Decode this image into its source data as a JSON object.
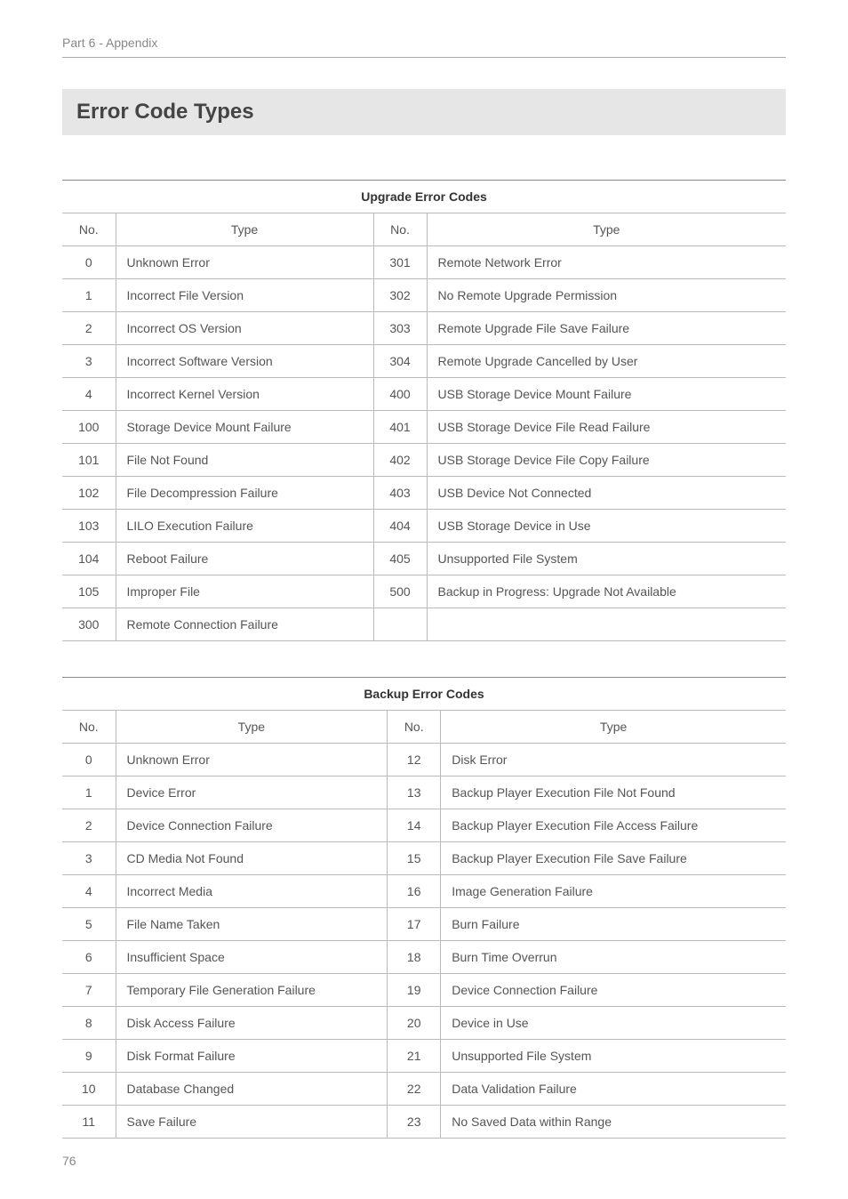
{
  "header": "Part 6 - Appendix",
  "section_title": "Error Code Types",
  "page_number": "76",
  "chart_data": [
    {
      "type": "table",
      "title": "Upgrade Error Codes",
      "columns": [
        "No.",
        "Type",
        "No.",
        "Type"
      ],
      "rows": [
        [
          "0",
          "Unknown Error",
          "301",
          "Remote Network Error"
        ],
        [
          "1",
          "Incorrect File Version",
          "302",
          "No Remote Upgrade Permission"
        ],
        [
          "2",
          "Incorrect OS Version",
          "303",
          "Remote Upgrade File Save Failure"
        ],
        [
          "3",
          "Incorrect Software Version",
          "304",
          "Remote Upgrade Cancelled by User"
        ],
        [
          "4",
          "Incorrect Kernel Version",
          "400",
          "USB Storage Device Mount Failure"
        ],
        [
          "100",
          "Storage Device Mount Failure",
          "401",
          "USB Storage Device File Read Failure"
        ],
        [
          "101",
          "File Not Found",
          "402",
          "USB Storage Device File Copy Failure"
        ],
        [
          "102",
          "File Decompression Failure",
          "403",
          "USB Device Not Connected"
        ],
        [
          "103",
          "LILO Execution Failure",
          "404",
          "USB Storage Device in Use"
        ],
        [
          "104",
          "Reboot Failure",
          "405",
          "Unsupported File System"
        ],
        [
          "105",
          "Improper File",
          "500",
          "Backup in Progress: Upgrade Not Available"
        ],
        [
          "300",
          "Remote Connection Failure",
          "",
          ""
        ]
      ]
    },
    {
      "type": "table",
      "title": "Backup Error Codes",
      "columns": [
        "No.",
        "Type",
        "No.",
        "Type"
      ],
      "rows": [
        [
          "0",
          "Unknown Error",
          "12",
          "Disk Error"
        ],
        [
          "1",
          "Device Error",
          "13",
          "Backup Player Execution File Not Found"
        ],
        [
          "2",
          "Device Connection Failure",
          "14",
          "Backup Player Execution File Access Failure"
        ],
        [
          "3",
          "CD Media Not Found",
          "15",
          "Backup Player Execution File Save Failure"
        ],
        [
          "4",
          "Incorrect Media",
          "16",
          "Image Generation Failure"
        ],
        [
          "5",
          "File Name Taken",
          "17",
          "Burn Failure"
        ],
        [
          "6",
          "Insufficient Space",
          "18",
          "Burn Time Overrun"
        ],
        [
          "7",
          "Temporary File Generation Failure",
          "19",
          "Device Connection Failure"
        ],
        [
          "8",
          "Disk Access Failure",
          "20",
          "Device in Use"
        ],
        [
          "9",
          "Disk Format Failure",
          "21",
          "Unsupported File System"
        ],
        [
          "10",
          "Database Changed",
          "22",
          "Data Validation Failure"
        ],
        [
          "11",
          "Save Failure",
          "23",
          "No Saved Data within Range"
        ]
      ]
    }
  ]
}
